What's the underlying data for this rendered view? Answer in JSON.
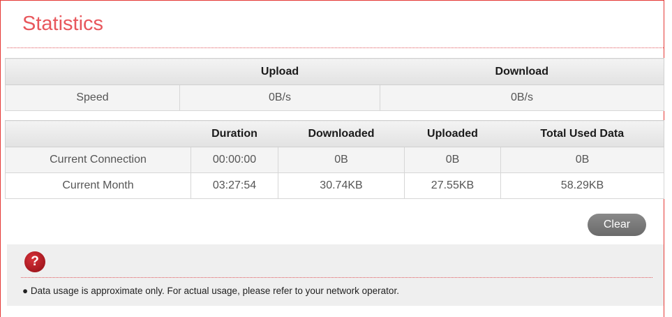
{
  "page": {
    "title": "Statistics"
  },
  "speed_table": {
    "headers": [
      "",
      "Upload",
      "Download"
    ],
    "row": {
      "label": "Speed",
      "upload": "0B/s",
      "download": "0B/s"
    }
  },
  "usage_table": {
    "headers": [
      "",
      "Duration",
      "Downloaded",
      "Uploaded",
      "Total Used Data"
    ],
    "rows": [
      {
        "label": "Current Connection",
        "duration": "00:00:00",
        "downloaded": "0B",
        "uploaded": "0B",
        "total": "0B"
      },
      {
        "label": "Current Month",
        "duration": "03:27:54",
        "downloaded": "30.74KB",
        "uploaded": "27.55KB",
        "total": "58.29KB"
      }
    ]
  },
  "actions": {
    "clear_label": "Clear"
  },
  "help": {
    "icon": "question-icon",
    "icon_glyph": "?",
    "note": "● Data usage is approximate only. For actual usage, please refer to your network operator."
  },
  "colors": {
    "accent": "#e8575c",
    "border": "#e53935",
    "help_icon": "#b71c1c",
    "button": "#7a7a7a"
  }
}
